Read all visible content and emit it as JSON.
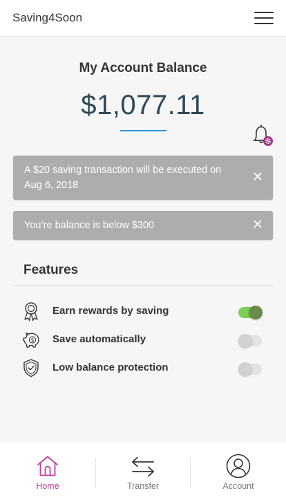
{
  "header": {
    "app_title": "Saving4Soon",
    "menu_icon": "hamburger-menu-icon"
  },
  "balance": {
    "heading": "My Account Balance",
    "amount": "$1,077.11"
  },
  "notifications": {
    "bell_icon": "bell-settings-icon",
    "items": [
      {
        "text": "A $20 saving transaction will be executed on Aug 6, 2018"
      },
      {
        "text": "You’re balance is below $300"
      }
    ]
  },
  "features": {
    "title": "Features",
    "items": [
      {
        "label": "Earn rewards by saving",
        "icon": "award-ribbon-icon",
        "enabled": true
      },
      {
        "label": "Save automatically",
        "icon": "piggy-bank-icon",
        "enabled": false
      },
      {
        "label": "Low balance protection",
        "icon": "shield-check-icon",
        "enabled": false
      }
    ]
  },
  "nav": {
    "items": [
      {
        "label": "Home",
        "icon": "home-icon",
        "active": true
      },
      {
        "label": "Transfer",
        "icon": "transfer-arrows-icon",
        "active": false
      },
      {
        "label": "Account",
        "icon": "user-account-icon",
        "active": false
      }
    ]
  },
  "colors": {
    "accent_pink": "#c23c9d",
    "balance_text": "#2e4858",
    "underline_blue": "#2a8fd6",
    "toggle_on": "#7dcf53",
    "notice_bg": "#adadad"
  }
}
